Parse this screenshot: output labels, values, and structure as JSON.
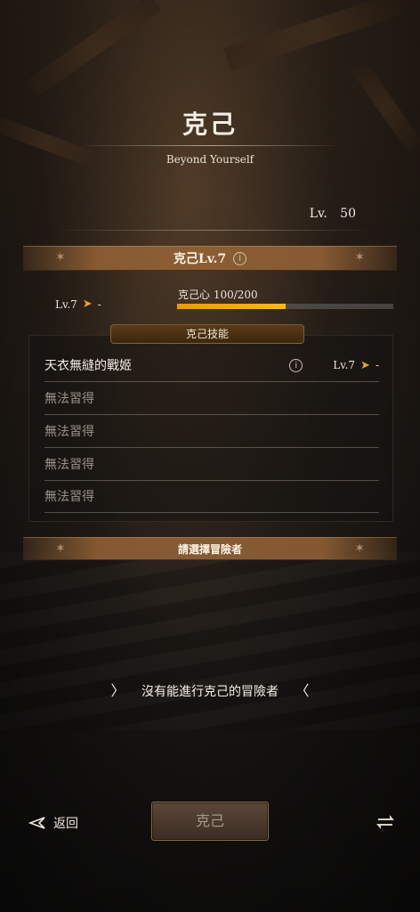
{
  "header": {
    "title": "克己",
    "subtitle": "Beyond Yourself"
  },
  "level": {
    "prefix": "Lv.",
    "value": "50"
  },
  "restraint_band": {
    "label": "克己Lv.7",
    "info": "i"
  },
  "current": {
    "level_label": "Lv.7",
    "next_value": "-"
  },
  "gauge": {
    "label": "克己心 100/200",
    "fill_fraction": 0.5
  },
  "skills": {
    "tab_label": "克己技能",
    "rows": [
      {
        "name": "天衣無縫的戰姬",
        "info": "i",
        "level": "Lv.7",
        "next": "-"
      },
      {
        "name": "無法習得"
      },
      {
        "name": "無法習得"
      },
      {
        "name": "無法習得"
      },
      {
        "name": "無法習得"
      }
    ]
  },
  "select_band": {
    "label": "請選擇冒險者"
  },
  "notice": {
    "text": "沒有能進行克己的冒險者",
    "left_chevron": "〉",
    "right_chevron": "〈"
  },
  "footer": {
    "back_label": "返回",
    "confirm_label": "克己"
  },
  "icons": {
    "back": "back-arrow-icon",
    "swap": "swap-icon",
    "arrow": "orange-arrow-icon"
  },
  "colors": {
    "accent": "#f0a21a",
    "gauge_fill": "#ffb52a",
    "band": "#96643a"
  }
}
